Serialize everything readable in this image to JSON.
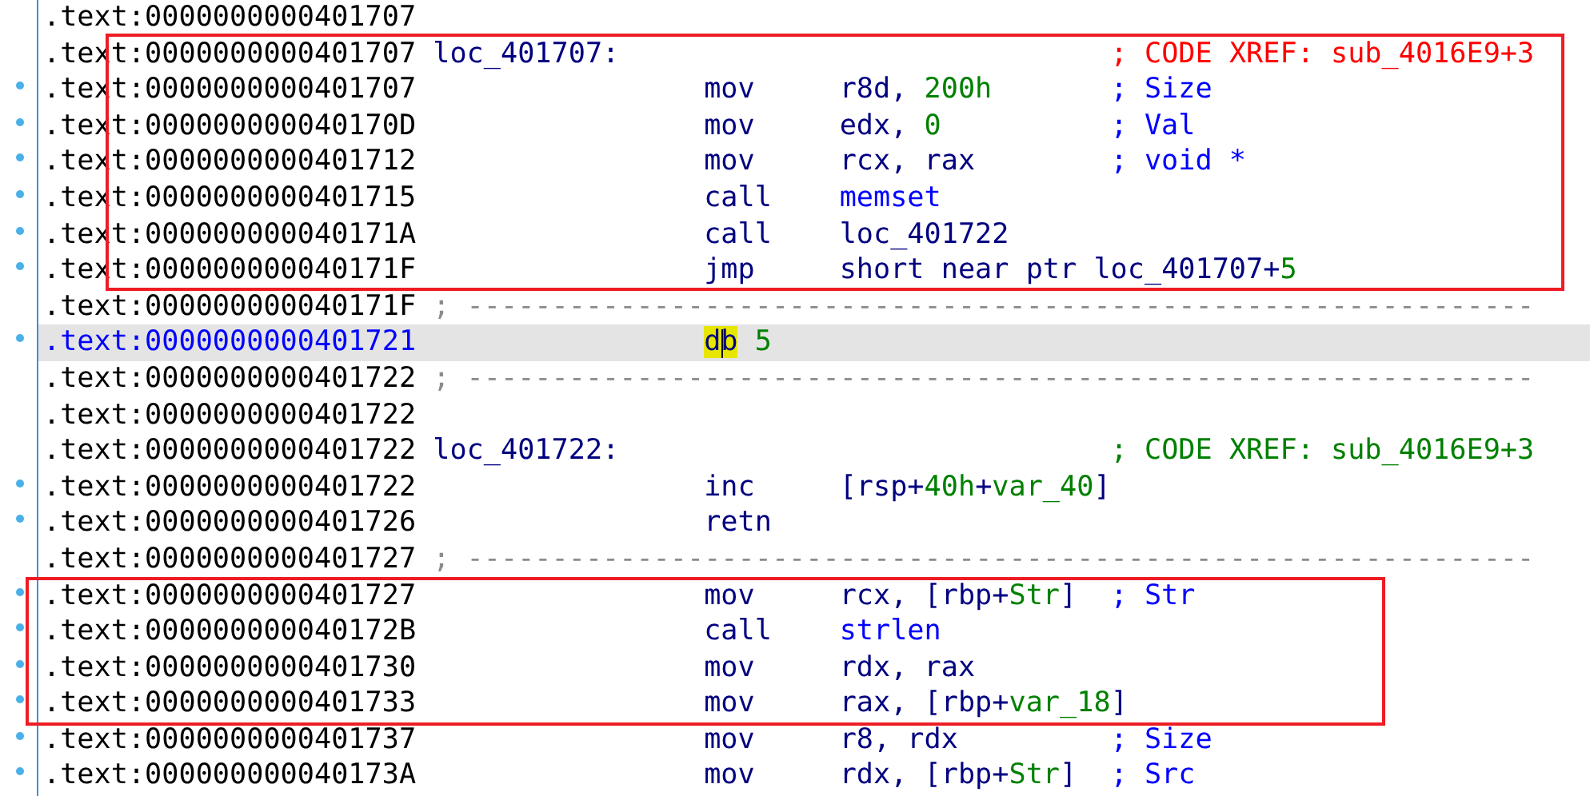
{
  "rows": [
    {
      "address": ".text:0000000000401707",
      "kind": "blank",
      "marker": false,
      "selected": false
    },
    {
      "address": ".text:0000000000401707",
      "kind": "label",
      "marker": false,
      "selected": false,
      "label": "loc_401707:",
      "comment": {
        "text": "; CODE XREF: sub_4016E9+3",
        "color": "#ff0000"
      }
    },
    {
      "address": ".text:0000000000401707",
      "kind": "instr",
      "marker": true,
      "selected": false,
      "mnemonic": "mov",
      "operands": [
        {
          "text": "r8d, ",
          "kind": "plain"
        },
        {
          "text": "200h",
          "kind": "num"
        }
      ],
      "comment": {
        "text": "; Size",
        "color": "#0000ff"
      }
    },
    {
      "address": ".text:000000000040170D",
      "kind": "instr",
      "marker": true,
      "selected": false,
      "mnemonic": "mov",
      "operands": [
        {
          "text": "edx, ",
          "kind": "plain"
        },
        {
          "text": "0",
          "kind": "num"
        }
      ],
      "comment": {
        "text": "; Val",
        "color": "#0000ff"
      }
    },
    {
      "address": ".text:0000000000401712",
      "kind": "instr",
      "marker": true,
      "selected": false,
      "mnemonic": "mov",
      "operands": [
        {
          "text": "rcx, rax",
          "kind": "plain"
        }
      ],
      "comment": {
        "text": "; void *",
        "color": "#0000ff"
      }
    },
    {
      "address": ".text:0000000000401715",
      "kind": "instr",
      "marker": true,
      "selected": false,
      "mnemonic": "call",
      "operands": [
        {
          "text": "memset",
          "kind": "func"
        }
      ]
    },
    {
      "address": ".text:000000000040171A",
      "kind": "instr",
      "marker": true,
      "selected": false,
      "mnemonic": "call",
      "operands": [
        {
          "text": "loc_401722",
          "kind": "plain"
        }
      ]
    },
    {
      "address": ".text:000000000040171F",
      "kind": "instr",
      "marker": true,
      "selected": false,
      "mnemonic": "jmp",
      "operands": [
        {
          "text": "short near ptr loc_401707+",
          "kind": "plain"
        },
        {
          "text": "5",
          "kind": "num"
        }
      ]
    },
    {
      "address": ".text:000000000040171F",
      "kind": "separator",
      "marker": false,
      "selected": false,
      "separator": "; ---------------------------------------------------------------"
    },
    {
      "address": ".text:0000000000401721",
      "kind": "data",
      "marker": true,
      "selected": true,
      "mnemonic": "db",
      "operands": [
        {
          "text": "5",
          "kind": "num"
        }
      ]
    },
    {
      "address": ".text:0000000000401722",
      "kind": "separator",
      "marker": false,
      "selected": false,
      "separator": "; ---------------------------------------------------------------"
    },
    {
      "address": ".text:0000000000401722",
      "kind": "blank",
      "marker": false,
      "selected": false
    },
    {
      "address": ".text:0000000000401722",
      "kind": "label",
      "marker": false,
      "selected": false,
      "label": "loc_401722:",
      "comment": {
        "text": "; CODE XREF: sub_4016E9+3",
        "color": "#008000"
      }
    },
    {
      "address": ".text:0000000000401722",
      "kind": "instr",
      "marker": true,
      "selected": false,
      "mnemonic": "inc",
      "operands": [
        {
          "text": "[rsp+",
          "kind": "plain"
        },
        {
          "text": "40h",
          "kind": "num"
        },
        {
          "text": "+",
          "kind": "plain"
        },
        {
          "text": "var_40",
          "kind": "var"
        },
        {
          "text": "]",
          "kind": "plain"
        }
      ]
    },
    {
      "address": ".text:0000000000401726",
      "kind": "instr",
      "marker": true,
      "selected": false,
      "mnemonic": "retn"
    },
    {
      "address": ".text:0000000000401727",
      "kind": "separator",
      "marker": false,
      "selected": false,
      "separator": "; ---------------------------------------------------------------"
    },
    {
      "address": ".text:0000000000401727",
      "kind": "instr",
      "marker": true,
      "selected": false,
      "mnemonic": "mov",
      "operands": [
        {
          "text": "rcx, [rbp+",
          "kind": "plain"
        },
        {
          "text": "Str",
          "kind": "var"
        },
        {
          "text": "]",
          "kind": "plain"
        }
      ],
      "comment": {
        "text": "; Str",
        "color": "#0000ff"
      }
    },
    {
      "address": ".text:000000000040172B",
      "kind": "instr",
      "marker": true,
      "selected": false,
      "mnemonic": "call",
      "operands": [
        {
          "text": "strlen",
          "kind": "func"
        }
      ]
    },
    {
      "address": ".text:0000000000401730",
      "kind": "instr",
      "marker": true,
      "selected": false,
      "mnemonic": "mov",
      "operands": [
        {
          "text": "rdx, rax",
          "kind": "plain"
        }
      ]
    },
    {
      "address": ".text:0000000000401733",
      "kind": "instr",
      "marker": true,
      "selected": false,
      "mnemonic": "mov",
      "operands": [
        {
          "text": "rax, [rbp+",
          "kind": "plain"
        },
        {
          "text": "var_18",
          "kind": "var"
        },
        {
          "text": "]",
          "kind": "plain"
        }
      ]
    },
    {
      "address": ".text:0000000000401737",
      "kind": "instr",
      "marker": true,
      "selected": false,
      "mnemonic": "mov",
      "operands": [
        {
          "text": "r8, rdx",
          "kind": "plain"
        }
      ],
      "comment": {
        "text": "; Size",
        "color": "#0000ff"
      }
    },
    {
      "address": ".text:000000000040173A",
      "kind": "instr",
      "marker": true,
      "selected": false,
      "mnemonic": "mov",
      "operands": [
        {
          "text": "rdx, [rbp+",
          "kind": "plain"
        },
        {
          "text": "Str",
          "kind": "var"
        },
        {
          "text": "]",
          "kind": "plain"
        }
      ],
      "comment": {
        "text": "; Src",
        "color": "#0000ff"
      }
    }
  ]
}
